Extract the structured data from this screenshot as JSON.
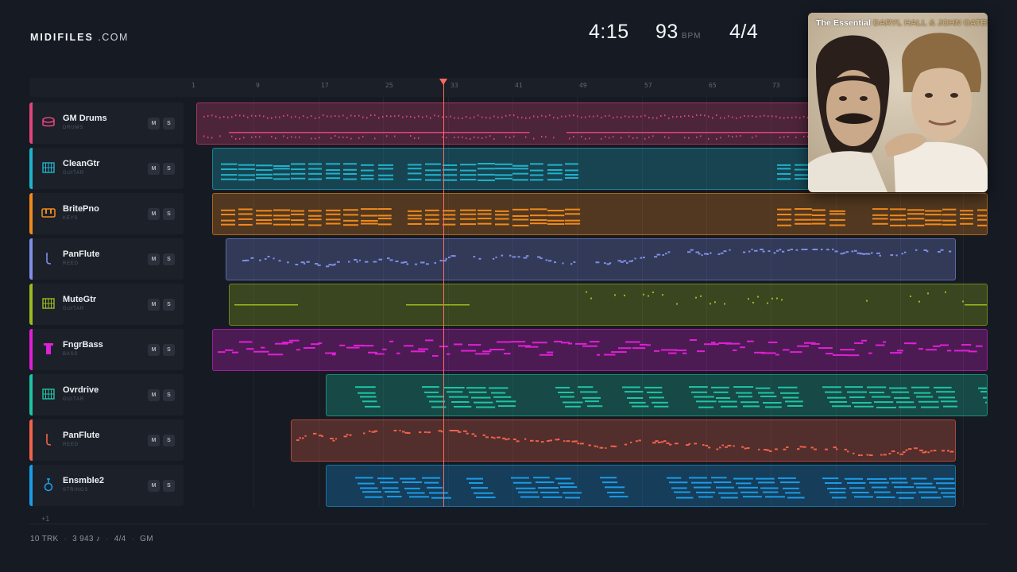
{
  "brand": {
    "bold": "MIDIFILES",
    "light": ".COM"
  },
  "stats": {
    "duration": "4:15",
    "bpm": "93",
    "bpm_unit": "BPM",
    "time_signature": "4/4"
  },
  "album": {
    "prefix": "The Essential",
    "artist": "DARYL HALL & JOHN OATES"
  },
  "ruler": {
    "ticks": [
      "1",
      "9",
      "17",
      "25",
      "33",
      "41",
      "49",
      "57",
      "65",
      "73"
    ]
  },
  "tracks": [
    {
      "name": "GM Drums",
      "category": "DRUMS",
      "icon": "drum-icon",
      "color": "#e0457b",
      "mute": "M",
      "solo": "S"
    },
    {
      "name": "CleanGtr",
      "category": "GUITAR",
      "icon": "guitar-icon",
      "color": "#1fb3cc",
      "mute": "M",
      "solo": "S"
    },
    {
      "name": "BritePno",
      "category": "KEYS",
      "icon": "piano-icon",
      "color": "#f08a1c",
      "mute": "M",
      "solo": "S"
    },
    {
      "name": "PanFlute",
      "category": "REED",
      "icon": "flute-icon",
      "color": "#7f8fe6",
      "mute": "M",
      "solo": "S"
    },
    {
      "name": "MuteGtr",
      "category": "GUITAR",
      "icon": "guitar-icon",
      "color": "#9cba1e",
      "mute": "M",
      "solo": "S"
    },
    {
      "name": "FngrBass",
      "category": "BASS",
      "icon": "bass-icon",
      "color": "#e01fd6",
      "mute": "M",
      "solo": "S"
    },
    {
      "name": "Ovrdrive",
      "category": "GUITAR",
      "icon": "guitar-icon",
      "color": "#1ec4a6",
      "mute": "M",
      "solo": "S"
    },
    {
      "name": "PanFlute",
      "category": "REED",
      "icon": "flute-icon",
      "color": "#f0634a",
      "mute": "M",
      "solo": "S"
    },
    {
      "name": "Ensmble2",
      "category": "STRINGS",
      "icon": "strings-icon",
      "color": "#1a9ce8",
      "mute": "M",
      "solo": "S"
    }
  ],
  "more_tracks": "+1",
  "footer": {
    "tracks": "10 TRK",
    "notes": "3 943 ♪",
    "time_signature": "4/4",
    "standard": "GM"
  }
}
